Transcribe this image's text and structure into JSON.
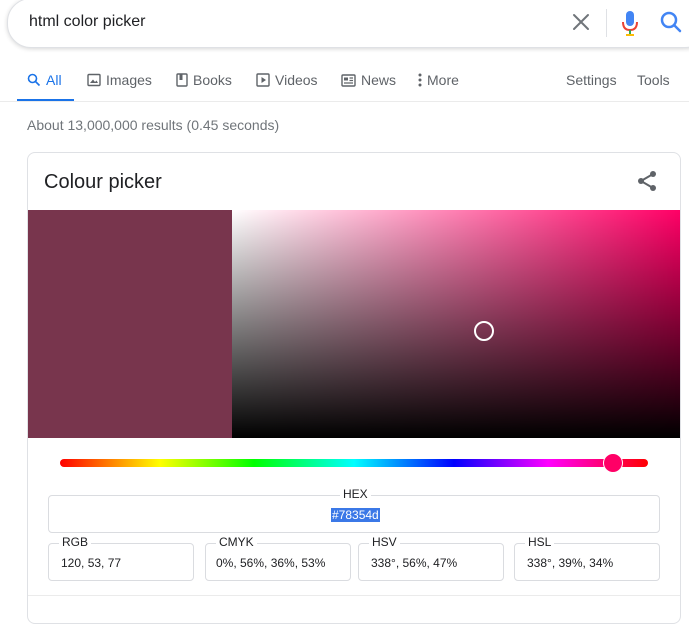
{
  "search": {
    "query": "html color picker",
    "clear_icon": "close-icon",
    "mic_icon": "microphone-icon",
    "search_icon": "search-icon"
  },
  "tabs": {
    "items": [
      {
        "label": "All",
        "icon": "search-icon",
        "active": true
      },
      {
        "label": "Images",
        "icon": "image-icon"
      },
      {
        "label": "Books",
        "icon": "book-icon"
      },
      {
        "label": "Videos",
        "icon": "play-icon"
      },
      {
        "label": "News",
        "icon": "news-icon"
      },
      {
        "label": "More",
        "icon": "more-vertical-icon"
      }
    ],
    "settings_label": "Settings",
    "tools_label": "Tools"
  },
  "stats": "About 13,000,000 results (0.45 seconds)",
  "picker": {
    "title": "Colour picker",
    "share_icon": "share-icon",
    "selected_color": "#78354d",
    "hue_color": "#ff0066",
    "hue_degrees": 338,
    "saturation_value": {
      "s": 0.56,
      "v": 0.47
    },
    "hex": {
      "label": "HEX",
      "value": "#78354d"
    },
    "rgb": {
      "label": "RGB",
      "value": "120, 53, 77"
    },
    "cmyk": {
      "label": "CMYK",
      "value": "0%, 56%, 36%, 53%"
    },
    "hsv": {
      "label": "HSV",
      "value": "338°, 56%, 47%"
    },
    "hsl": {
      "label": "HSL",
      "value": "338°, 39%, 34%"
    }
  },
  "colors": {
    "accent": "#1a73e8",
    "text_secondary": "#5f6368",
    "selection": "#3b78e7"
  }
}
